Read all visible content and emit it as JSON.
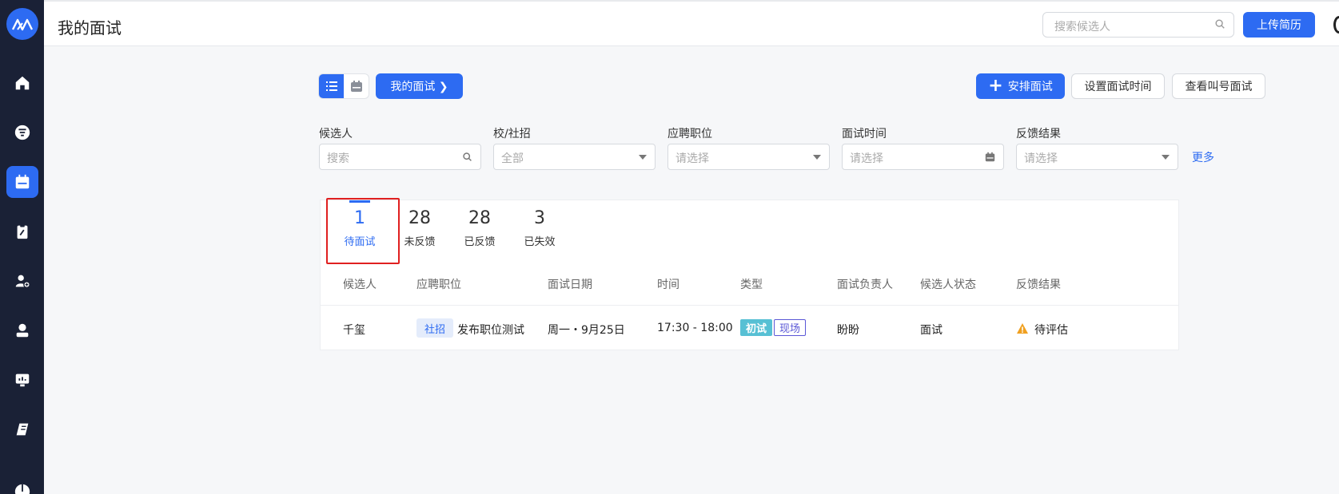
{
  "header": {
    "title": "我的面试",
    "search_placeholder": "搜索候选人",
    "upload_label": "上传简历"
  },
  "sidebar": {
    "items": [
      {
        "icon": "home-icon"
      },
      {
        "icon": "filter-icon"
      },
      {
        "icon": "calendar-icon",
        "active": true
      },
      {
        "icon": "clipboard-icon"
      },
      {
        "icon": "add-user-icon"
      },
      {
        "icon": "user-icon"
      },
      {
        "icon": "monitor-icon"
      },
      {
        "icon": "book-icon"
      },
      {
        "icon": "chart-icon"
      }
    ]
  },
  "toolbar": {
    "my_interviews_label": "我的面试 ❯",
    "arrange_label": "安排面试",
    "set_time_label": "设置面试时间",
    "call_label": "查看叫号面试"
  },
  "filters": {
    "candidate": {
      "label": "候选人",
      "placeholder": "搜索"
    },
    "recruit_type": {
      "label": "校/社招",
      "value": "全部"
    },
    "position": {
      "label": "应聘职位",
      "placeholder": "请选择"
    },
    "time": {
      "label": "面试时间",
      "placeholder": "请选择"
    },
    "feedback": {
      "label": "反馈结果",
      "placeholder": "请选择"
    },
    "more_label": "更多"
  },
  "stats": [
    {
      "num": "1",
      "label": "待面试",
      "active": true
    },
    {
      "num": "28",
      "label": "未反馈"
    },
    {
      "num": "28",
      "label": "已反馈"
    },
    {
      "num": "3",
      "label": "已失效"
    }
  ],
  "table": {
    "columns": [
      "候选人",
      "应聘职位",
      "面试日期",
      "时间",
      "类型",
      "面试负责人",
      "候选人状态",
      "反馈结果"
    ],
    "rows": [
      {
        "candidate": "千玺",
        "position_tag": "社招",
        "position": "发布职位测试",
        "date": "周一・9月25日",
        "time": "17:30 - 18:00",
        "type_round": "初试",
        "type_mode": "现场",
        "owner": "盼盼",
        "status": "面试",
        "feedback": "待评估"
      }
    ]
  },
  "colors": {
    "accent": "#2d6bf2",
    "sidebar": "#1a2136",
    "highlight": "#e02020"
  }
}
